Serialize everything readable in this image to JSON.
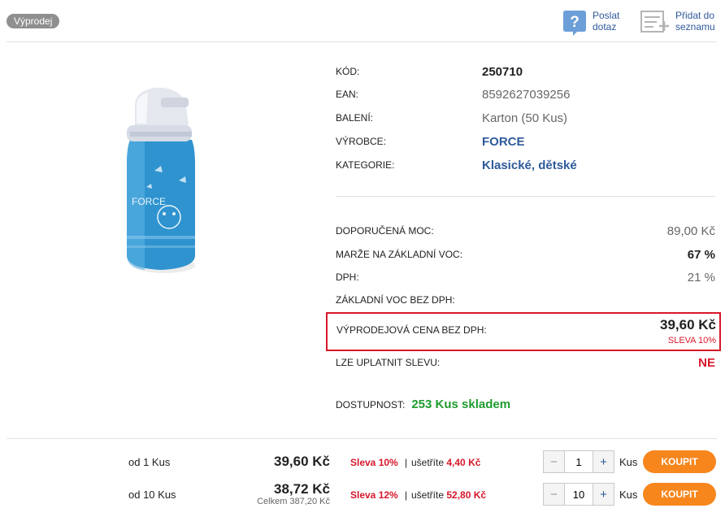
{
  "badge": "Výprodej",
  "actions": {
    "ask": {
      "line1": "Poslat",
      "line2": "dotaz",
      "icon": "question-icon"
    },
    "list": {
      "line1": "Přidat do",
      "line2": "seznamu",
      "icon": "add-to-list-icon"
    }
  },
  "details": [
    {
      "label": "KÓD:",
      "value": "250710",
      "style": "bold"
    },
    {
      "label": "EAN:",
      "value": "8592627039256",
      "style": "plain"
    },
    {
      "label": "BALENÍ:",
      "value": "Karton (50 Kus)",
      "style": "plain"
    },
    {
      "label": "VÝROBCE:",
      "value": "FORCE",
      "style": "link"
    },
    {
      "label": "KATEGORIE:",
      "value": "Klasické, dětské",
      "style": "link"
    }
  ],
  "prices": {
    "recommended": {
      "label": "DOPORUČENÁ MOC:",
      "value": "89,00 Kč"
    },
    "margin": {
      "label": "MARŽE NA ZÁKLADNÍ VOC:",
      "value": "67 %"
    },
    "vat": {
      "label": "DPH:",
      "value": "21 %"
    },
    "base": {
      "label": "ZÁKLADNÍ VOC BEZ DPH:",
      "value": ""
    },
    "sale": {
      "label": "VÝPRODEJOVÁ CENA BEZ DPH:",
      "value": "39,60 Kč",
      "discount": "SLEVA 10%"
    },
    "apply_discount": {
      "label": "LZE UPLATNIT SLEVU:",
      "value": "NE"
    }
  },
  "availability": {
    "label": "DOSTUPNOST:",
    "value": "253 Kus skladem"
  },
  "tiers": [
    {
      "qty_label": "od 1 Kus",
      "price": "39,60 Kč",
      "total": "",
      "discount": "Sleva 10%",
      "save_label": "ušetříte",
      "save_value": "4,40 Kč",
      "quantity": "1",
      "unit": "Kus",
      "buy": "KOUPIT"
    },
    {
      "qty_label": "od 10 Kus",
      "price": "38,72 Kč",
      "total": "Celkem 387,20 Kč",
      "discount": "Sleva 12%",
      "save_label": "ušetříte",
      "save_value": "52,80 Kč",
      "quantity": "10",
      "unit": "Kus",
      "buy": "KOUPIT"
    }
  ],
  "colors": {
    "accent": "#2e5a9b",
    "sale_red": "#d7182a",
    "stock_green": "#1f9b2e",
    "buy_orange": "#f7861d"
  }
}
